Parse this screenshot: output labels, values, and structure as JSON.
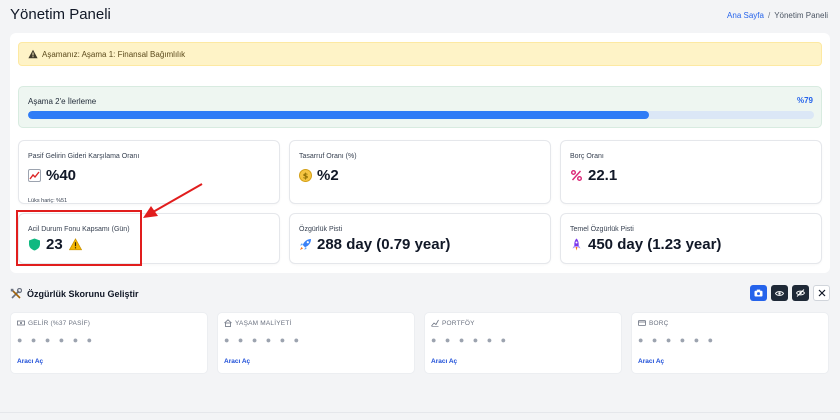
{
  "header": {
    "title": "Yönetim Paneli",
    "breadcrumb": {
      "home": "Ana Sayfa",
      "separator": "/",
      "current": "Yönetim Paneli"
    }
  },
  "alert": {
    "text": "Aşamanız: Aşama 1: Finansal Bağımlılık",
    "icon": "warning-triangle-icon"
  },
  "progress": {
    "label": "Aşama 2'e İlerleme",
    "value_text": "%79",
    "fraction": 0.79,
    "color": "#2f7cf6"
  },
  "stats": [
    {
      "label": "Pasif Gelirin Gideri Karşılama Oranı",
      "value": "%40",
      "sub": "Lüks hariç: %51",
      "icon": "chart-up-icon"
    },
    {
      "label": "Tasarruf Oranı (%)",
      "value": "%2",
      "icon": "coin-icon"
    },
    {
      "label": "Borç Oranı",
      "value": "22.1",
      "icon": "percent-icon"
    },
    {
      "label": "Acil Durum Fonu Kapsamı (Gün)",
      "value": "23",
      "icon": "shield-icon",
      "badge": "warning-icon"
    },
    {
      "label": "Özgürlük Pisti",
      "value": "288 day (0.79 year)",
      "icon": "rocket-icon"
    },
    {
      "label": "Temel Özgürlük Pisti",
      "value": "450 day (1.23 year)",
      "icon": "rocket-launch-icon"
    }
  ],
  "section": {
    "title": "Özgürlük Skorunu Geliştir",
    "toolbar": [
      "camera-icon",
      "eye-icon",
      "eye-slash-icon",
      "x-icon"
    ]
  },
  "tools": [
    {
      "label": "GELİR (%37 PASİF)",
      "masked": "● ● ● ● ● ●",
      "link": "Aracı Aç",
      "icon": "money-icon"
    },
    {
      "label": "YAŞAM MALİYETİ",
      "masked": "● ● ● ● ● ●",
      "link": "Aracı Aç",
      "icon": "house-icon"
    },
    {
      "label": "PORTFÖY",
      "masked": "● ● ● ● ● ●",
      "link": "Aracı Aç",
      "icon": "chart-line-icon"
    },
    {
      "label": "BORÇ",
      "masked": "● ● ● ● ● ●",
      "link": "Aracı Aç",
      "icon": "card-icon"
    }
  ],
  "colors": {
    "accent": "#2563eb",
    "alert_bg": "#fef3c7",
    "highlight": "#e11d1d"
  }
}
